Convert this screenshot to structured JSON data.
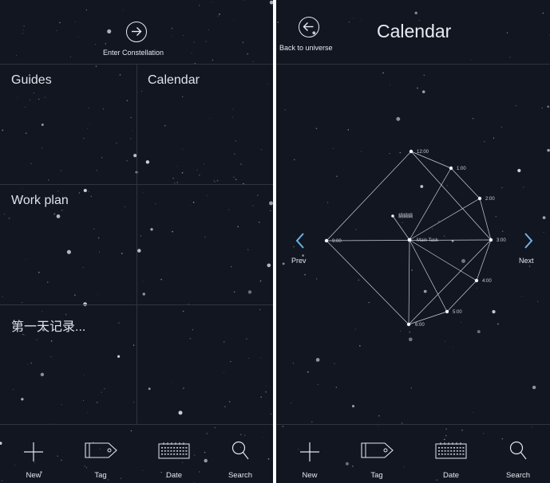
{
  "left_screen": {
    "enter_label": "Enter Constellation",
    "cells": [
      {
        "title": "Guides"
      },
      {
        "title": "Calendar"
      },
      {
        "title": "Work plan"
      },
      {
        "title": ""
      },
      {
        "title": "第一天记录..."
      },
      {
        "title": ""
      }
    ]
  },
  "right_screen": {
    "back_label": "Back to universe",
    "title": "Calendar",
    "prev_label": "Prev",
    "next_label": "Next",
    "center_node": "Main Task",
    "extra_node": "鍋鍋鍋",
    "hour_nodes": [
      "12:00",
      "1:00",
      "2:00",
      "3:00",
      "4:00",
      "5:00",
      "6:00",
      "9:00"
    ]
  },
  "tabbar": {
    "new_label": "New",
    "tag_label": "Tag",
    "date_label": "Date",
    "search_label": "Search"
  },
  "colors": {
    "background": "#111620",
    "line": "#2f3540",
    "text": "#e6e9ef",
    "accent": "#6fb3e8"
  },
  "icons": [
    "arrow-right-circle-icon",
    "arrow-left-circle-icon",
    "plus-icon",
    "tag-icon",
    "calendar-icon",
    "search-icon",
    "chevron-left-icon",
    "chevron-right-icon"
  ]
}
